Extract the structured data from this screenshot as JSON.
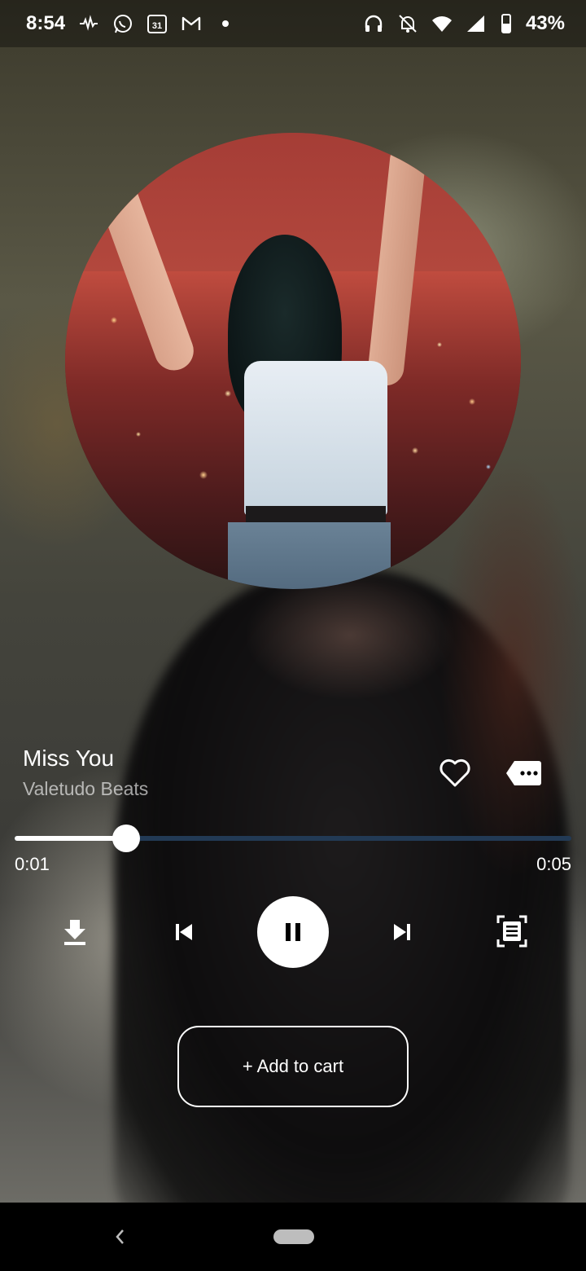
{
  "status_bar": {
    "time": "8:54",
    "left_icons": [
      "activity-icon",
      "whatsapp-icon",
      "calendar-icon",
      "gmail-icon",
      "dot-icon"
    ],
    "calendar_day": "31",
    "right_icons": [
      "headphones-icon",
      "bell-off-icon",
      "wifi-icon",
      "signal-icon",
      "battery-icon"
    ],
    "battery_percent": "43%"
  },
  "player": {
    "track_title": "Miss You",
    "artist": "Valetudo Beats",
    "elapsed": "0:01",
    "duration": "0:05",
    "progress_fraction": 0.2,
    "state": "playing"
  },
  "controls": {
    "download_icon": "download-icon",
    "prev_icon": "skip-previous-icon",
    "play_pause_icon": "pause-icon",
    "next_icon": "skip-next-icon",
    "lyrics_icon": "lyrics-icon",
    "like_icon": "heart-outline-icon",
    "comment_icon": "comment-icon"
  },
  "cart": {
    "label": "+ Add to cart"
  },
  "nav": {
    "back_icon": "back-chevron-icon",
    "home_icon": "home-pill-icon"
  },
  "colors": {
    "progress_track": "#223a55",
    "progress_fill": "#ffffff",
    "accent": "#ffffff"
  }
}
